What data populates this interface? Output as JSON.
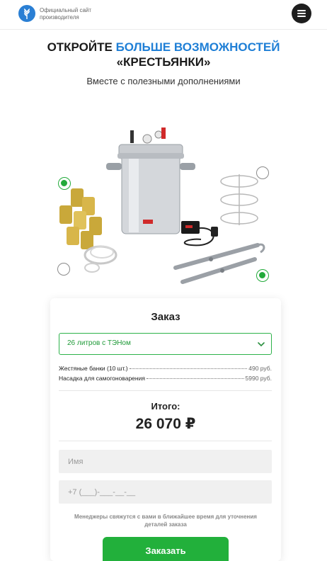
{
  "header": {
    "logo_text": "Официальный сайт производителя",
    "menu_icon": "menu-icon"
  },
  "hero": {
    "title_part1": "ОТКРОЙТЕ ",
    "title_accent": "БОЛЬШЕ ВОЗМОЖНОСТЕЙ",
    "title_part2": "«КРЕСТЬЯНКИ»",
    "subtitle": "Вместе с полезными дополнениями"
  },
  "addons": [
    {
      "name": "tin-cans",
      "selected": true
    },
    {
      "name": "lid-gasket",
      "selected": false
    },
    {
      "name": "dehydrator-trays",
      "selected": false
    },
    {
      "name": "distiller-attachment",
      "selected": true
    }
  ],
  "order": {
    "title": "Заказ",
    "select_value": "26 литров с ТЭНом",
    "items": [
      {
        "name": "Жестяные банки (10 шт.)",
        "price": "490 руб."
      },
      {
        "name": "Насадка для самогоноварения",
        "price": "5990 руб."
      }
    ],
    "total_label": "Итого:",
    "total_value": "26 070 ₽",
    "name_placeholder": "Имя",
    "phone_placeholder": "+7 (___)-___-__-__",
    "note": "Менеджеры свяжутся с вами в ближайшее время для уточнения деталей заказа",
    "submit_label": "Заказать"
  },
  "colors": {
    "accent_blue": "#1f7fd6",
    "accent_green": "#22b03b",
    "text_dark": "#222222"
  }
}
